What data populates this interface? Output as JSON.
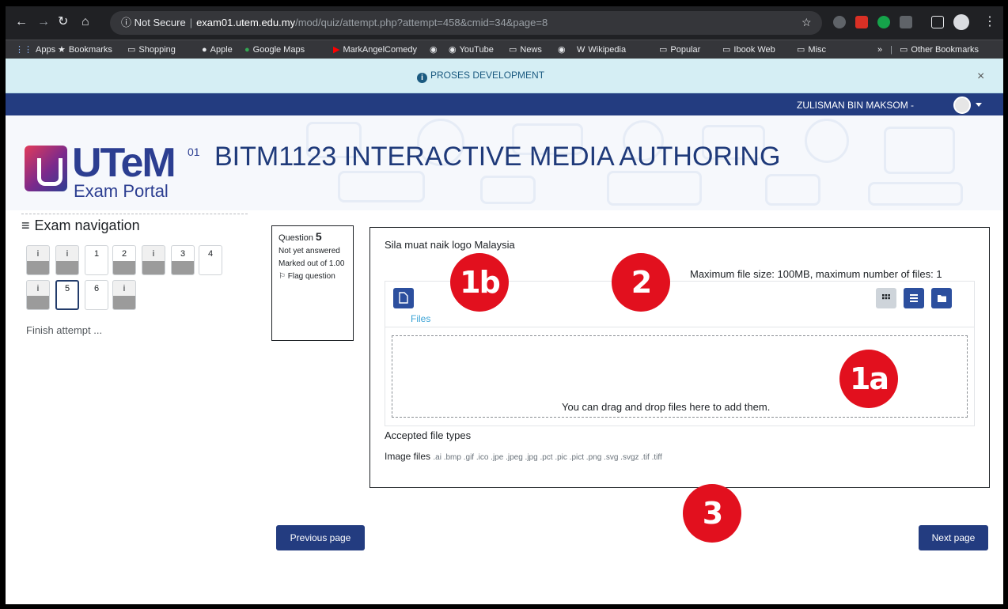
{
  "browser": {
    "security_label": "Not Secure",
    "url_host": "exam01.utem.edu.my",
    "url_path": "/mod/quiz/attempt.php?attempt=458&cmid=34&page=8",
    "icons": [
      "back-icon",
      "forward-icon",
      "reload-icon",
      "home-icon",
      "info-icon",
      "star-icon",
      "profile-icon",
      "menu-icon"
    ]
  },
  "bookmarks": {
    "items": [
      "Apps",
      "Bookmarks",
      "Shopping",
      "Apple",
      "Google Maps",
      "MarkAngelComedy",
      "YouTube",
      "News",
      "Wikipedia",
      "Popular",
      "Ibook Web",
      "Misc"
    ],
    "more": "»",
    "other": "Other Bookmarks"
  },
  "alert": {
    "text": "PROSES DEVELOPMENT",
    "close": "×"
  },
  "user": {
    "name": "ZULISMAN BIN MAKSOM -"
  },
  "header": {
    "logo_mark": "UTeM",
    "logo_sup": "01",
    "logo_sub": "Exam Portal",
    "course_title": "BITM1123 INTERACTIVE MEDIA AUTHORING"
  },
  "nav": {
    "title": "Exam navigation",
    "buttons": [
      "i",
      "i",
      "1",
      "2",
      "i",
      "3",
      "4",
      "i",
      "5",
      "6",
      "i"
    ],
    "finish": "Finish attempt ..."
  },
  "question_info": {
    "label": "Question",
    "number": "5",
    "state": "Not yet answered",
    "marks": "Marked out of 1.00",
    "flag": "Flag question"
  },
  "question": {
    "text": "Sila muat naik logo Malaysia",
    "max_info": "Maximum file size: 100MB, maximum number of files: 1",
    "files_label": "Files",
    "drop_text": "You can drag and drop files here to add them.",
    "accepted_label": "Accepted file types",
    "filetypes_label": "Image files",
    "filetypes_ext": ".ai .bmp .gif .ico .jpe .jpeg .jpg .pct .pic .pict .png .svg .svgz .tif .tiff"
  },
  "buttons": {
    "previous": "Previous page",
    "next": "Next page"
  },
  "markers": [
    "1b",
    "2",
    "1a",
    "3"
  ],
  "colors": {
    "brand_navy": "#233c80",
    "marker_red": "#e2101e",
    "alert_bg": "#d5eef4"
  }
}
